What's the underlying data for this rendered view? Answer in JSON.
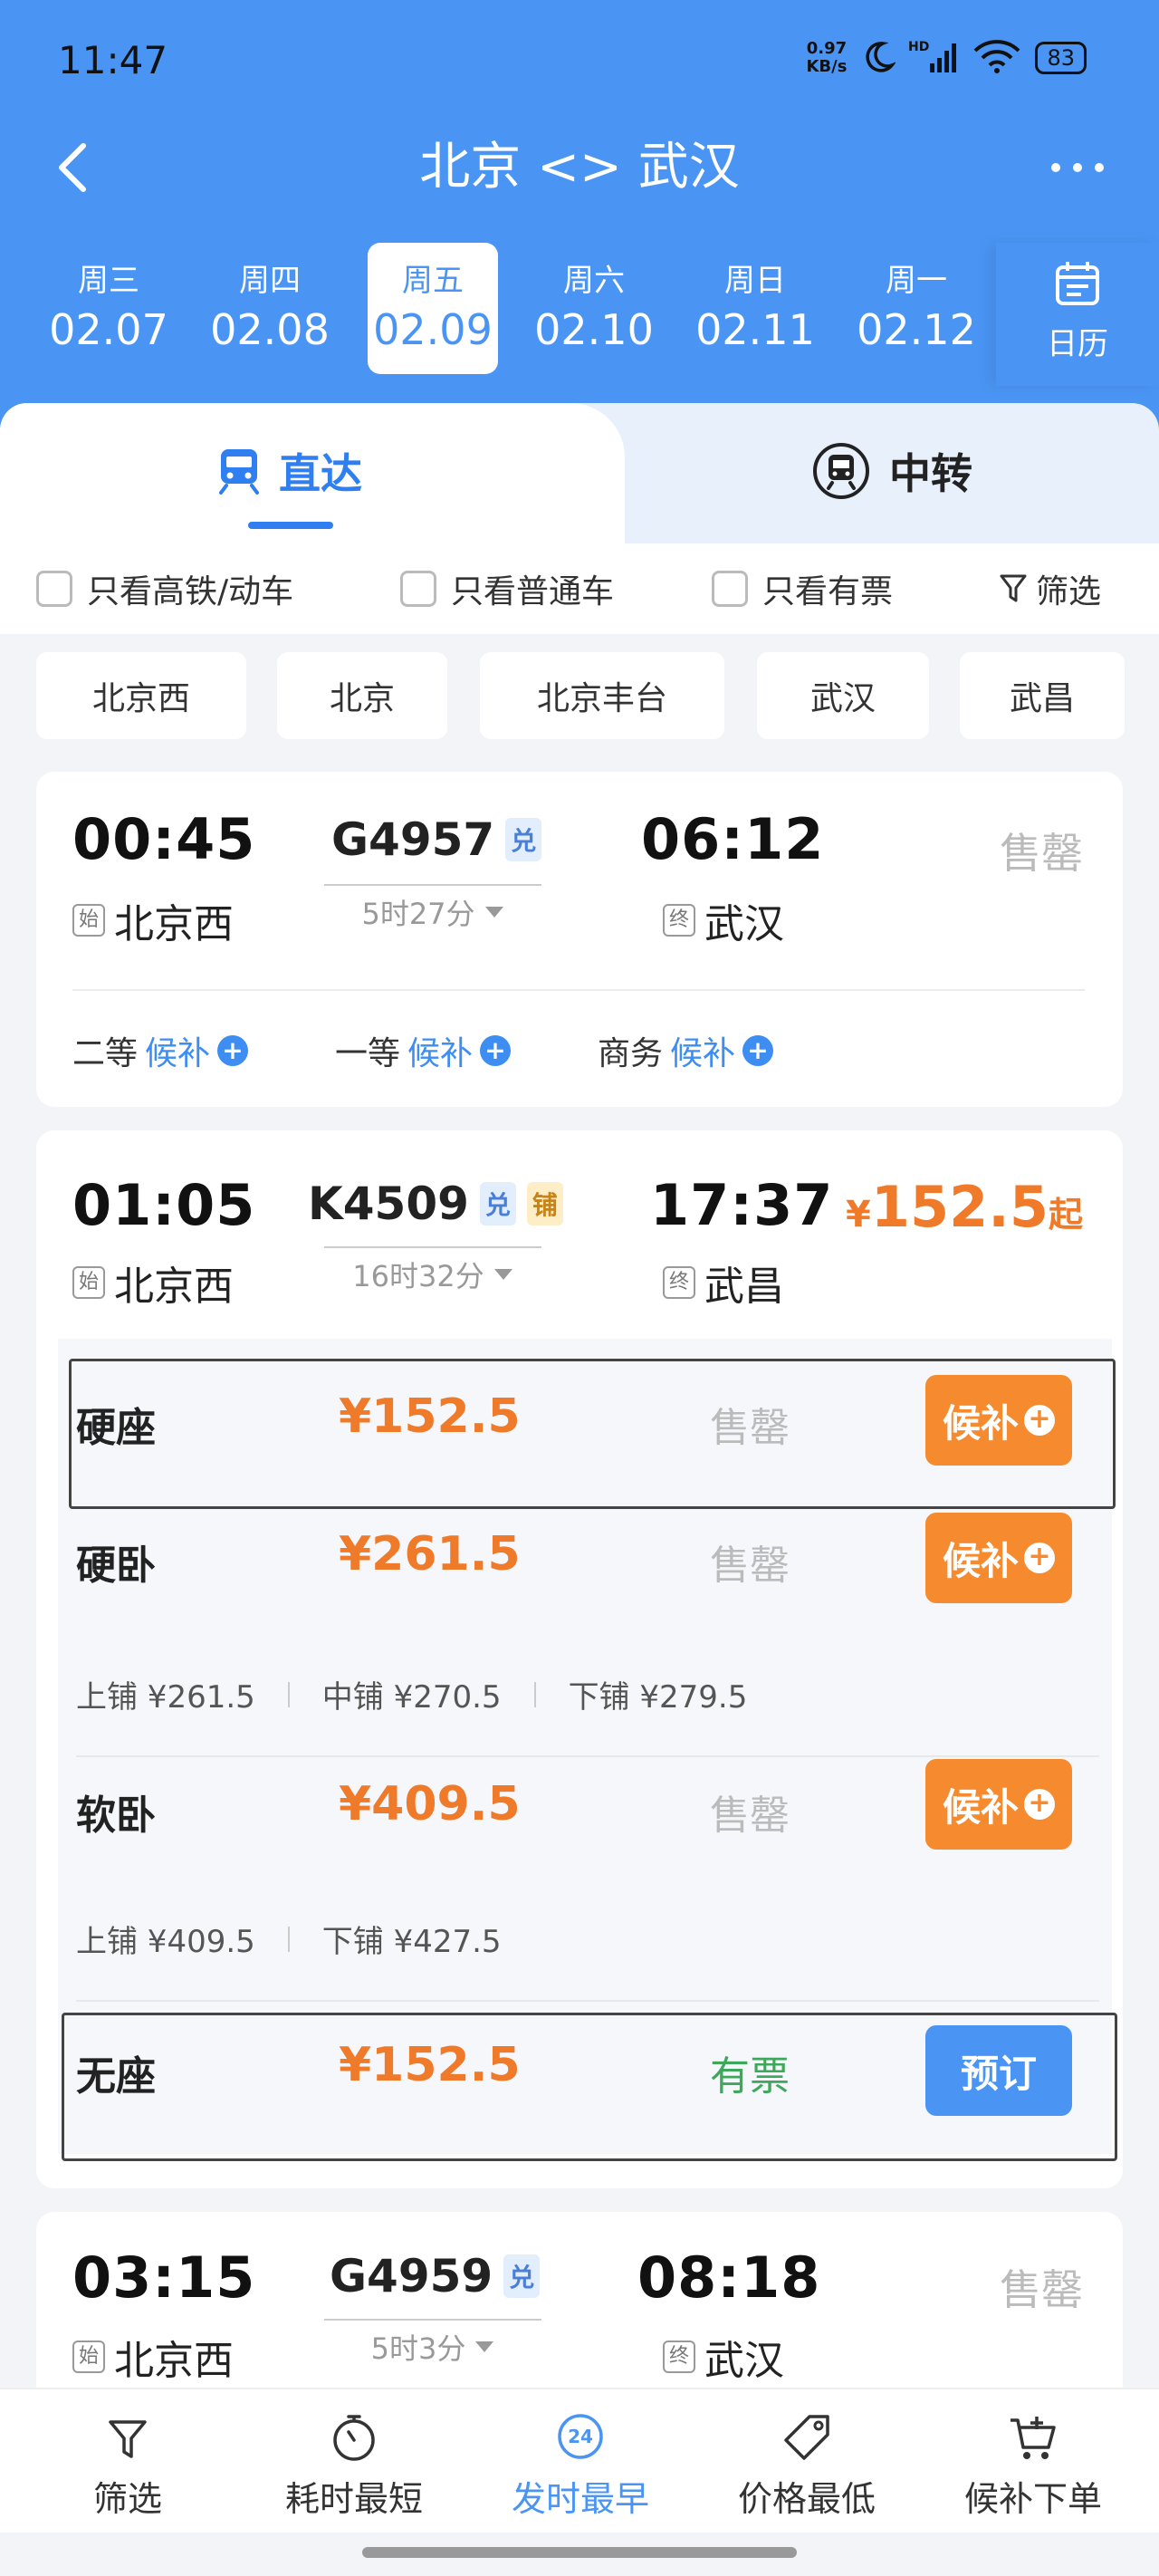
{
  "status_bar": {
    "time": "11:47",
    "net_speed_value": "0.97",
    "net_speed_unit": "KB/s",
    "battery": "83"
  },
  "header": {
    "route": "北京 <> 武汉"
  },
  "dates": [
    {
      "weekday": "周三",
      "date": "02.07"
    },
    {
      "weekday": "周四",
      "date": "02.08"
    },
    {
      "weekday": "周五",
      "date": "02.09"
    },
    {
      "weekday": "周六",
      "date": "02.10"
    },
    {
      "weekday": "周日",
      "date": "02.11"
    },
    {
      "weekday": "周一",
      "date": "02.12"
    }
  ],
  "calendar_label": "日历",
  "tabs": {
    "direct": "直达",
    "transfer": "中转"
  },
  "filters": {
    "high_speed": "只看高铁/动车",
    "normal": "只看普通车",
    "available": "只看有票",
    "filter": "筛选"
  },
  "stations": [
    "北京西",
    "北京",
    "北京丰台",
    "武汉",
    "武昌"
  ],
  "trains": [
    {
      "dep_time": "00:45",
      "dep_station": "北京西",
      "dep_badge": "始",
      "train_no": "G4957",
      "tags": [
        "兑"
      ],
      "duration": "5时27分",
      "arr_time": "06:12",
      "arr_station": "武汉",
      "arr_badge": "终",
      "status": "售罄",
      "seats": [
        {
          "class": "二等",
          "state": "候补"
        },
        {
          "class": "一等",
          "state": "候补"
        },
        {
          "class": "商务",
          "state": "候补"
        }
      ]
    },
    {
      "dep_time": "01:05",
      "dep_station": "北京西",
      "dep_badge": "始",
      "train_no": "K4509",
      "tags": [
        "兑",
        "铺"
      ],
      "duration": "16时32分",
      "arr_time": "17:37",
      "arr_station": "武昌",
      "arr_badge": "终",
      "price_symbol": "¥",
      "price": "152.5",
      "price_suffix": "起",
      "seat_rows": [
        {
          "name": "硬座",
          "price": "¥152.5",
          "status": "售罄",
          "action": "候补"
        },
        {
          "name": "硬卧",
          "price": "¥261.5",
          "status": "售罄",
          "action": "候补",
          "berths": [
            "上铺 ¥261.5",
            "中铺 ¥270.5",
            "下铺 ¥279.5"
          ]
        },
        {
          "name": "软卧",
          "price": "¥409.5",
          "status": "售罄",
          "action": "候补",
          "berths": [
            "上铺 ¥409.5",
            "下铺 ¥427.5"
          ]
        },
        {
          "name": "无座",
          "price": "¥152.5",
          "status": "有票",
          "action": "预订"
        }
      ]
    },
    {
      "dep_time": "03:15",
      "dep_station": "北京西",
      "dep_badge": "始",
      "train_no": "G4959",
      "tags": [
        "兑"
      ],
      "duration": "5时3分",
      "arr_time": "08:18",
      "arr_station": "武汉",
      "arr_badge": "终",
      "status": "售罄"
    }
  ],
  "bottom_nav": [
    {
      "label": "筛选",
      "icon": "funnel-icon"
    },
    {
      "label": "耗时最短",
      "icon": "stopwatch-icon"
    },
    {
      "label": "发时最早",
      "icon": "clock-24-icon",
      "icon_text": "24"
    },
    {
      "label": "价格最低",
      "icon": "price-tag-icon"
    },
    {
      "label": "候补下单",
      "icon": "cart-plus-icon"
    }
  ],
  "colors": {
    "brand_blue": "#4a95f4",
    "price_orange": "#ef7a2a",
    "available_green": "#3ea85a"
  }
}
